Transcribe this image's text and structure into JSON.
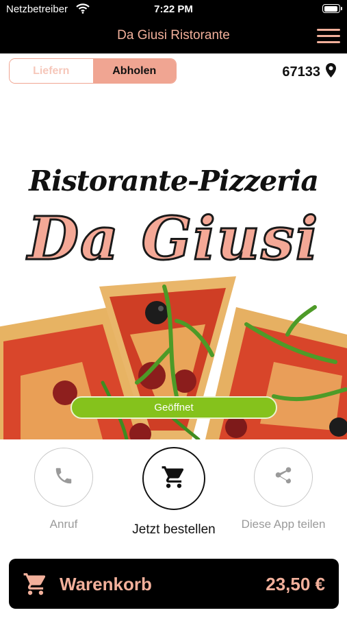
{
  "status_bar": {
    "carrier": "Netzbetreiber",
    "time": "7:22 PM"
  },
  "nav": {
    "title": "Da Giusi Ristorante",
    "menu_icon": "hamburger-menu-icon"
  },
  "delivery_toggle": {
    "options": [
      "Liefern",
      "Abholen"
    ],
    "selected": "Abholen"
  },
  "location": {
    "postal_code": "67133",
    "icon": "location-pin-icon"
  },
  "hero": {
    "subtitle": "Ristorante-Pizzeria",
    "brand": "Da Giusi",
    "status": "Geöffnet",
    "status_color": "#85c21c"
  },
  "actions": [
    {
      "label": "Anruf",
      "icon": "phone-icon"
    },
    {
      "label": "Jetzt bestellen",
      "icon": "shopping-cart-icon"
    },
    {
      "label": "Diese App teilen",
      "icon": "share-icon"
    }
  ],
  "cart": {
    "label": "Warenkorb",
    "total": "23,50 €",
    "icon": "shopping-cart-icon"
  },
  "colors": {
    "accent": "#f2b09b",
    "bar": "#000000",
    "open": "#85c21c"
  }
}
